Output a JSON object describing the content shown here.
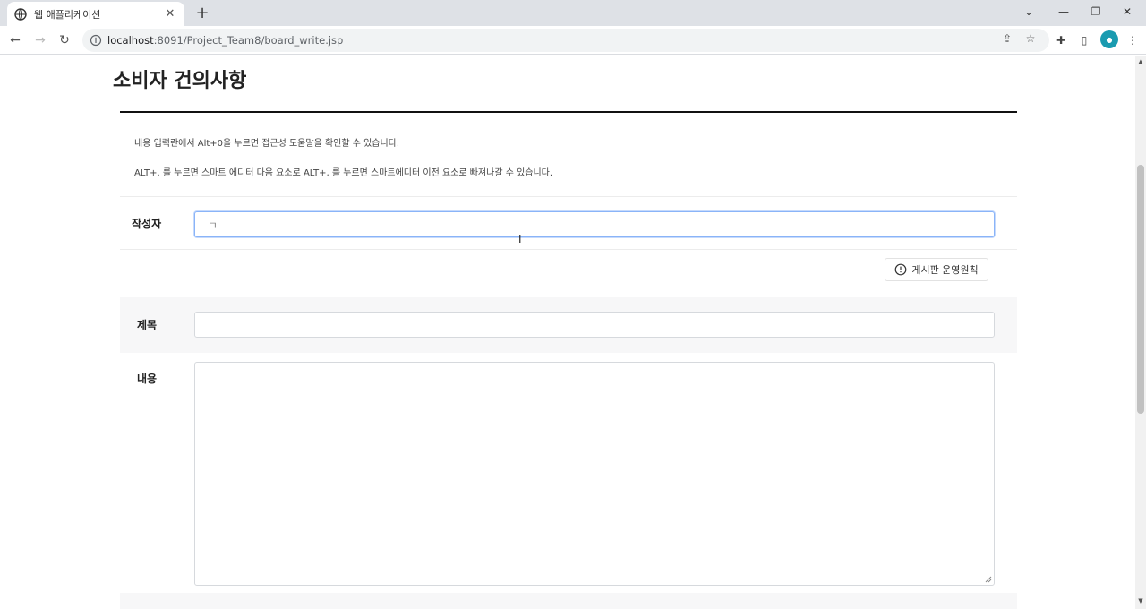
{
  "browser": {
    "tab_title": "웹 애플리케이션",
    "url_host": "localhost",
    "url_path": ":8091/Project_Team8/board_write.jsp"
  },
  "page": {
    "title": "소비자 건의사항",
    "help_line_1": "내용 입력란에서 Alt+0을 누르면 접근성 도움말을 확인할 수 있습니다.",
    "help_line_2": "ALT+. 를 누르면 스마트 에디터 다음 요소로 ALT+, 를 누르면 스마트에디터 이전 요소로 빠져나갈 수 있습니다.",
    "author_label": "작성자",
    "author_value": "ㄱ",
    "rules_button_label": "게시판 운영원칙",
    "subject_label": "제목",
    "subject_value": "",
    "content_label": "내용",
    "content_value": ""
  },
  "colors": {
    "focus": "#8ab4f8",
    "avatar": "#1a9bb0"
  }
}
